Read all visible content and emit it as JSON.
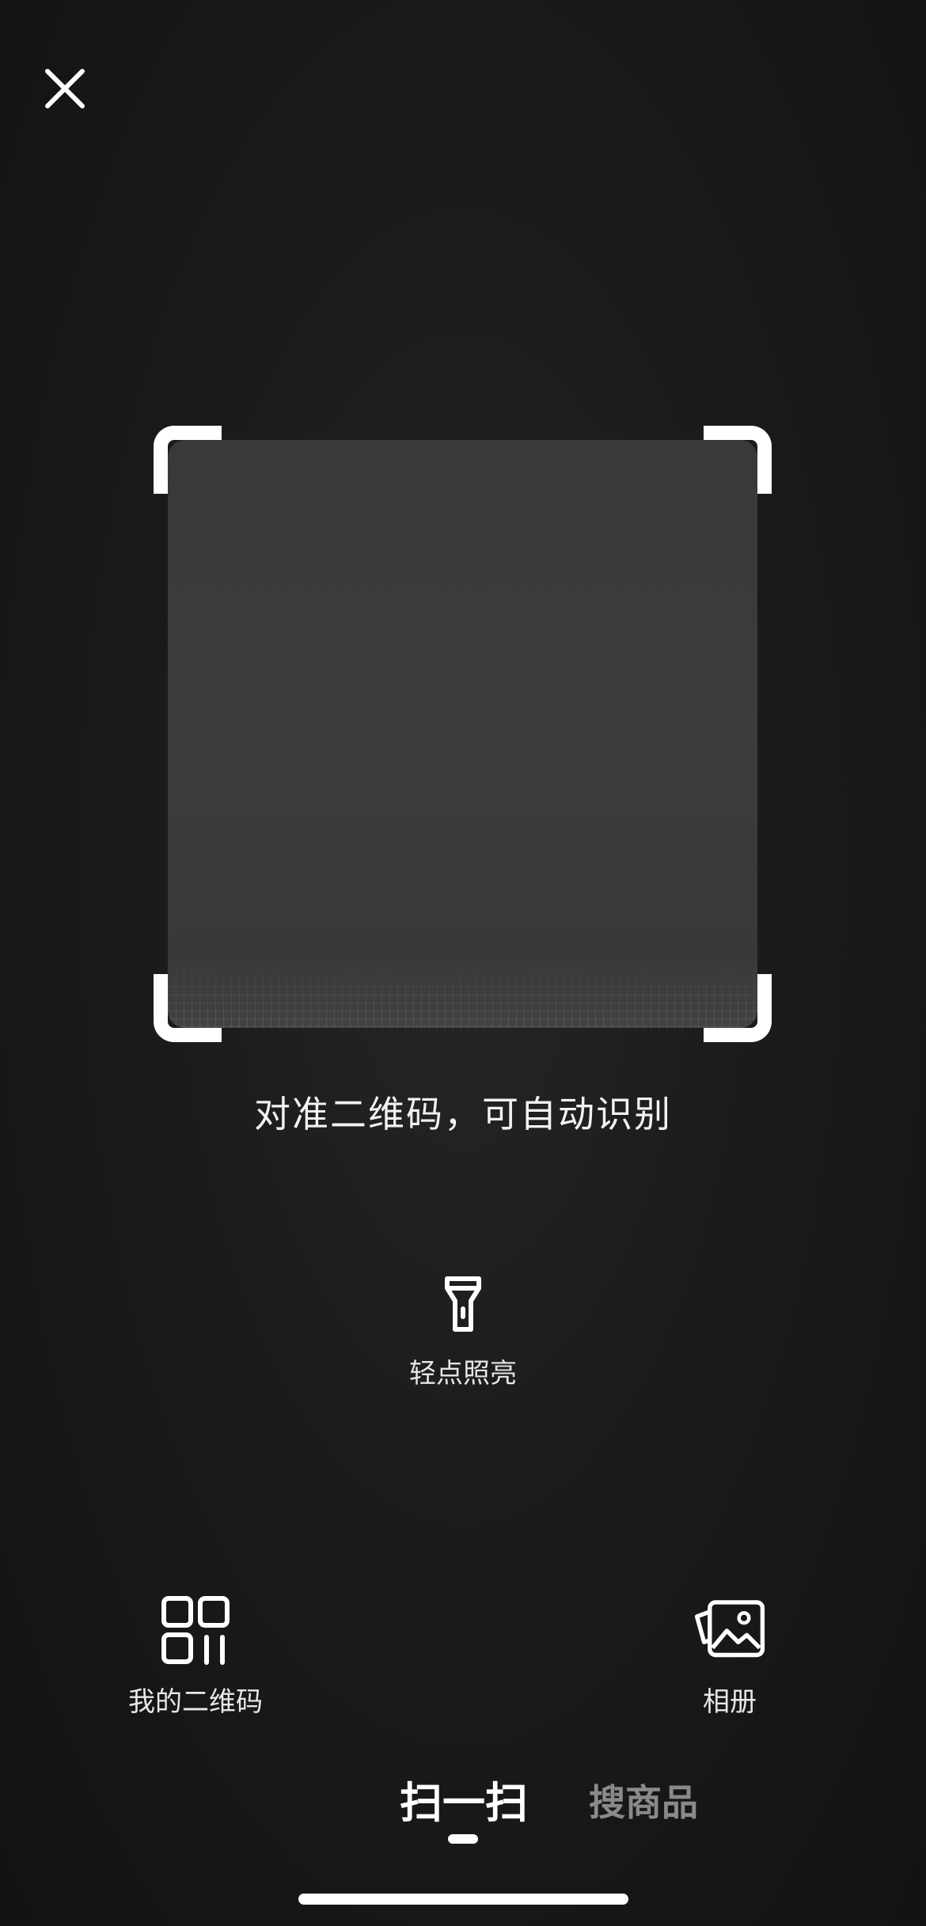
{
  "header": {
    "close_icon": "close-icon"
  },
  "scanner": {
    "hint": "对准二维码，可自动识别"
  },
  "torch": {
    "icon": "flashlight-icon",
    "label": "轻点照亮"
  },
  "actions": {
    "my_qrcode": {
      "icon": "qr-code-icon",
      "label": "我的二维码"
    },
    "album": {
      "icon": "photo-album-icon",
      "label": "相册"
    }
  },
  "tabs": [
    {
      "label": "扫一扫",
      "active": true
    },
    {
      "label": "搜商品",
      "active": false
    }
  ],
  "colors": {
    "background": "#1b1b1c",
    "accent": "#ffffff",
    "inactive_tab": "#8a8a8a"
  }
}
